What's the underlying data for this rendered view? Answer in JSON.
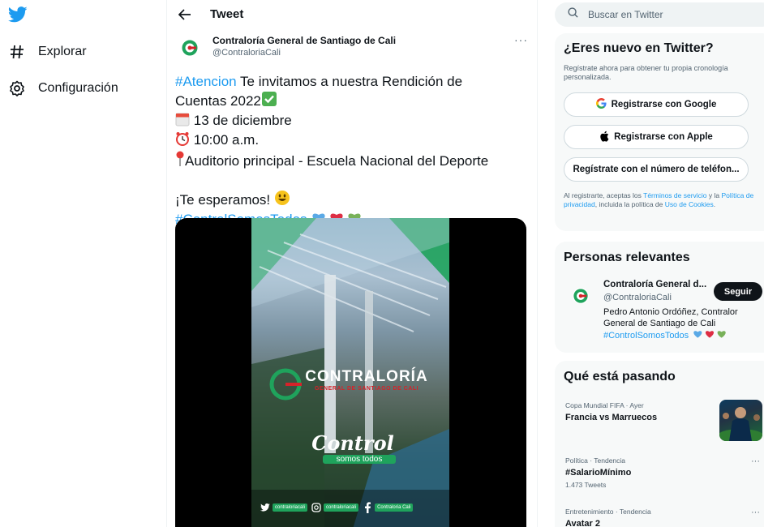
{
  "nav": {
    "items": [
      {
        "label": "Explorar",
        "icon": "hashtag-icon"
      },
      {
        "label": "Configuración",
        "icon": "gear-icon"
      }
    ]
  },
  "header": {
    "title": "Tweet"
  },
  "tweet": {
    "author_name": "Contraloría General de Santiago de Cali",
    "author_handle": "@ContraloriaCali",
    "hashtag_atencion": "#Atencion",
    "line1_rest": " Te invitamos a nuestra Rendición de",
    "line2": "Cuentas 2022",
    "date": "13 de diciembre",
    "time": "10:00 a.m.",
    "place": "Auditorio principal - Escuela Nacional del Deporte",
    "closing": "¡Te esperamos!",
    "hashtag_control": "#ControlSomosTodos"
  },
  "media": {
    "brand_title": "CONTRALORÍA",
    "brand_sub": "GENERAL DE SANTIAGO DE CALI",
    "script": "Control",
    "script_sub": "somos todos",
    "social": [
      "contraloriacali",
      "contraloriacali",
      "Contraloria Cali"
    ]
  },
  "search": {
    "placeholder": "Buscar en Twitter"
  },
  "signup": {
    "title": "¿Eres nuevo en Twitter?",
    "subtitle": "Regístrate ahora para obtener tu propia cronología personalizada.",
    "google": "Registrarse con Google",
    "apple": "Registrarse con Apple",
    "phone": "Regístrate con el número de teléfon...",
    "terms_prefix": "Al registrarte, aceptas los ",
    "terms_link": "Términos de servicio",
    "terms_mid": " y la ",
    "privacy_link": "Política de privacidad",
    "terms_mid2": ", incluida la política de ",
    "cookies_link": "Uso de Cookies",
    "terms_end": "."
  },
  "relevant": {
    "title": "Personas relevantes",
    "name": "Contraloría General d...",
    "handle": "@ContraloriaCali",
    "follow": "Seguir",
    "bio": "Pedro Antonio Ordóñez, Contralor General de Santiago de Cali",
    "bio_tag": "#ControlSomosTodos"
  },
  "trends": {
    "title": "Qué está pasando",
    "items": [
      {
        "meta": "Copa Mundial FIFA · Ayer",
        "name": "Francia vs Marruecos"
      },
      {
        "meta": "Política · Tendencia",
        "name": "#SalarioMínimo",
        "count": "1.473 Tweets"
      },
      {
        "meta": "Entretenimiento · Tendencia",
        "name": "Avatar 2"
      }
    ]
  },
  "colors": {
    "accent": "#1d9bf0",
    "text": "#0f1419",
    "muted": "#536471",
    "card": "#f7f9f9"
  }
}
